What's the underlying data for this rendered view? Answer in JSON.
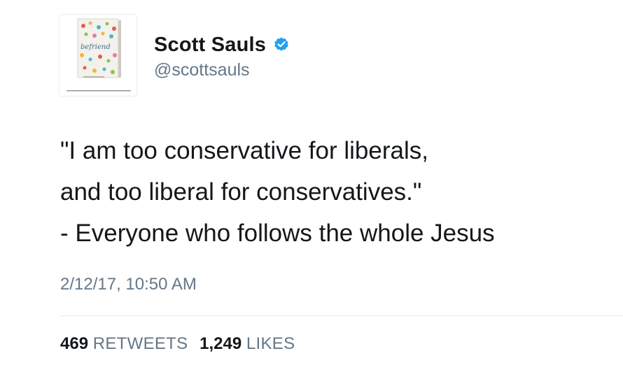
{
  "user": {
    "display_name": "Scott Sauls",
    "handle": "@scottsauls",
    "verified": true,
    "verified_icon": "verified-badge-icon",
    "avatar": {
      "description_icon": "book-cover-avatar",
      "book_title": "befriend"
    }
  },
  "tweet": {
    "lines": [
      "\"I am too conservative for liberals,",
      "and too liberal for conservatives.\"",
      "- Everyone who follows the whole Jesus"
    ],
    "timestamp": "2/12/17, 10:50 AM"
  },
  "stats": {
    "retweets_count": "469",
    "retweets_label": "RETWEETS",
    "likes_count": "1,249",
    "likes_label": "LIKES"
  },
  "colors": {
    "text_primary": "#14171a",
    "text_secondary": "#657786",
    "verified_blue": "#1da1f2",
    "divider": "#e1e8ed"
  }
}
